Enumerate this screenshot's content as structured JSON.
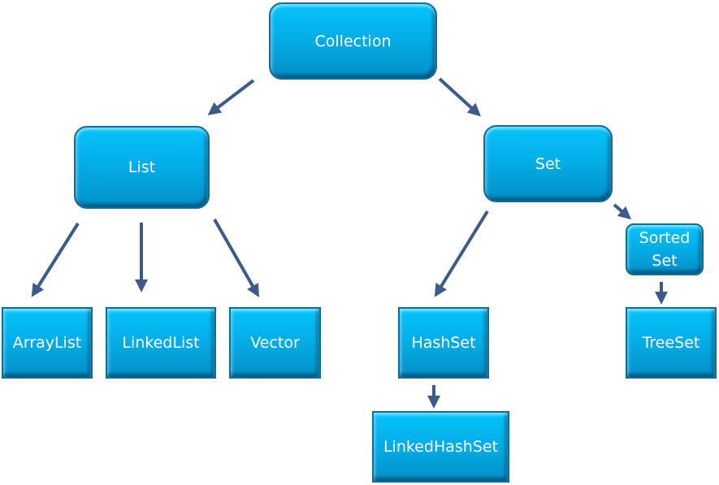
{
  "nodes": {
    "collection": "Collection",
    "list": "List",
    "set": "Set",
    "sorted_set": "Sorted Set",
    "arraylist": "ArrayList",
    "linkedlist": "LinkedList",
    "vector": "Vector",
    "hashset": "HashSet",
    "treeset": "TreeSet",
    "linkedhashset": "LinkedHashSet"
  },
  "edges": [
    [
      "Collection",
      "List"
    ],
    [
      "Collection",
      "Set"
    ],
    [
      "List",
      "ArrayList"
    ],
    [
      "List",
      "LinkedList"
    ],
    [
      "List",
      "Vector"
    ],
    [
      "Set",
      "HashSet"
    ],
    [
      "Set",
      "Sorted Set"
    ],
    [
      "Sorted Set",
      "TreeSet"
    ],
    [
      "HashSet",
      "LinkedHashSet"
    ]
  ],
  "colors": {
    "box": "#04aee8",
    "arrow": "#3d5a8a",
    "text": "#ffffff"
  }
}
